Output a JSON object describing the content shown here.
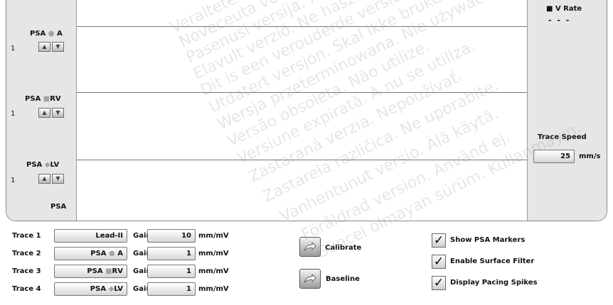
{
  "channels": [
    {
      "prefix": "PSA",
      "symbol": "●",
      "name": "A",
      "value": "1"
    },
    {
      "prefix": "PSA",
      "symbol": "■",
      "name": "RV",
      "value": "1"
    },
    {
      "prefix": "PSA",
      "symbol": "◆",
      "name": "LV",
      "value": "1"
    },
    {
      "prefix": "PSA",
      "symbol": "",
      "name": "",
      "value": ""
    }
  ],
  "up_icon": "▲",
  "down_icon": "▼",
  "right_panel": {
    "vrate_symbol": "■",
    "vrate_label": "V Rate",
    "vrate_value": "- - -",
    "trace_speed_label": "Trace Speed",
    "trace_speed_value": "25",
    "trace_speed_unit": "mm/s"
  },
  "traces": [
    {
      "label": "Trace 1",
      "source_prefix": "Lead-II",
      "source_symbol": "",
      "source_name": "",
      "gain_label": "Gain",
      "gain": "10",
      "unit": "mm/mV"
    },
    {
      "label": "Trace 2",
      "source_prefix": "PSA",
      "source_symbol": "●",
      "source_name": "A",
      "gain_label": "Gain",
      "gain": "1",
      "unit": "mm/mV"
    },
    {
      "label": "Trace 3",
      "source_prefix": "PSA",
      "source_symbol": "■",
      "source_name": "RV",
      "gain_label": "Gain",
      "gain": "1",
      "unit": "mm/mV"
    },
    {
      "label": "Trace 4",
      "source_prefix": "PSA",
      "source_symbol": "◆",
      "source_name": "LV",
      "gain_label": "Gain",
      "gain": "1",
      "unit": "mm/mV"
    }
  ],
  "actions": {
    "calibrate_label": "Calibrate",
    "baseline_label": "Baseline",
    "action_icon": "arrow-icon"
  },
  "options": [
    {
      "label": "Show PSA Markers",
      "checked": true,
      "mark": "✓"
    },
    {
      "label": "Enable Surface Filter",
      "checked": true,
      "mark": "✓"
    },
    {
      "label": "Display Pacing Spikes",
      "checked": true,
      "mark": "✓"
    }
  ],
  "watermark": [
    "Veraltete Version. Nicht verwenden.",
    "Noveceuta version. Mhn thv xpnoimonoieite.",
    "Pasenusi versija. Nenaudokite.",
    "Elavult verzió. Ne használja!",
    "Dit is een verouderde versie. Niet gebruiken.",
    "Utdatert versjon. Skal ikke brukes.",
    "Wersja przeterminowana. Nie używać.",
    "Versão obsoleta. Não utilize.",
    "Versiune expirată. A nu se utiliza.",
    "Zastaraná verzia. Nepoužívať.",
    "Zastarela različica. Ne uporabite.",
    "Vanhentunut versio. Älä käytä.",
    "Föråldrad version. Använd ej.",
    "Güncel olmayan sürüm. Kullanmayın."
  ]
}
